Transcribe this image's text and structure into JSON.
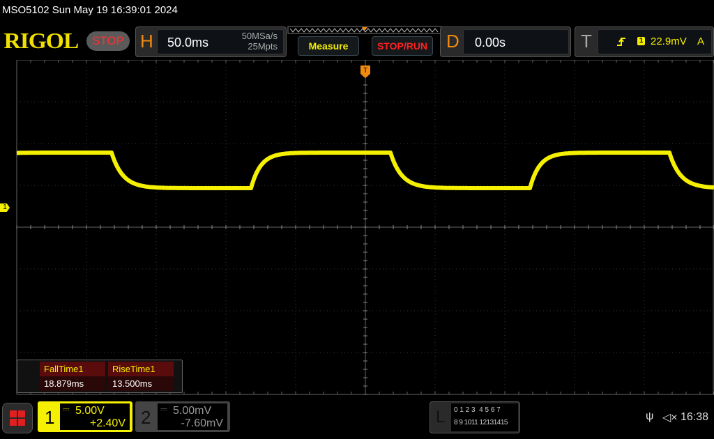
{
  "header": {
    "title": "MSO5102  Sun May 19 16:39:01 2024",
    "logo": "RIGOL",
    "run_state": "STOP"
  },
  "horizontal": {
    "letter": "H",
    "timebase": "50.0ms",
    "sample_rate": "50MSa/s",
    "memory_depth": "25Mpts"
  },
  "buttons": {
    "measure": "Measure",
    "stop_run": "STOP/RUN"
  },
  "delay": {
    "letter": "D",
    "value": "0.00s"
  },
  "trigger": {
    "letter": "T",
    "edge_icon": "rising-edge-icon",
    "source": "1",
    "level": "22.9mV",
    "mode": "A"
  },
  "channel_marker": "1",
  "measurements": [
    {
      "label": "FallTime1",
      "value": "18.879ms"
    },
    {
      "label": "RiseTime1",
      "value": "13.500ms"
    }
  ],
  "channels": [
    {
      "num": "1",
      "scale": "5.00V",
      "offset": "+2.40V",
      "coupling_icon": "dc-coupling-icon",
      "color": "#f5f000"
    },
    {
      "num": "2",
      "scale": "5.00mV",
      "offset": "-7.60mV",
      "coupling_icon": "dc-coupling-icon",
      "color": "#888888"
    }
  ],
  "logic": {
    "letter": "L",
    "row1": "0 1 2 3  4 5 6 7",
    "row2": "8 9 1011 12131415"
  },
  "status": {
    "usb_icon": "usb-icon",
    "mute_icon": "speaker-muted-icon",
    "time": "16:38"
  },
  "colors": {
    "trace": "#f5f000",
    "accent": "#f28a10",
    "stop": "#ff3030"
  }
}
